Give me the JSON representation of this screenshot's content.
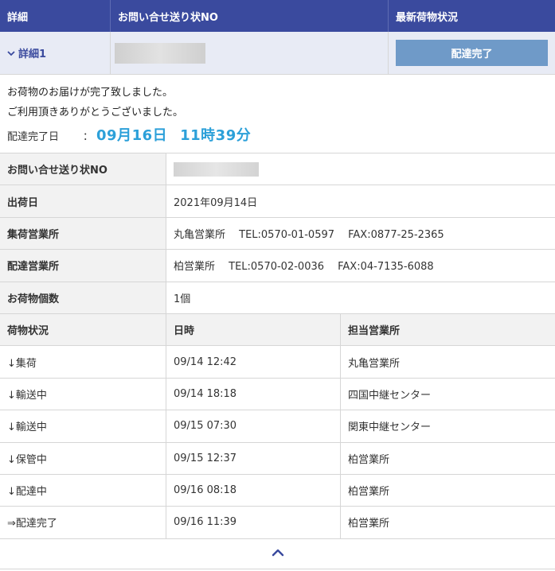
{
  "header": {
    "col1": "詳細",
    "col2": "お問い合せ送り状NO",
    "col3": "最新荷物状況"
  },
  "summary_row": {
    "detail_label": "詳細1",
    "status_button": "配達完了"
  },
  "message": {
    "line1": "お荷物のお届けが完了致しました。",
    "line2": "ご利用頂きありがとうございました。",
    "delivered_label": "配達完了日",
    "colon": "：",
    "delivered_date": "09月16日",
    "delivered_time": "11時39分"
  },
  "info": [
    {
      "label": "お問い合せ送り状NO",
      "value": ""
    },
    {
      "label": "出荷日",
      "value": "2021年09月14日"
    },
    {
      "label": "集荷営業所",
      "value": "丸亀営業所　 TEL:0570-01-0597　 FAX:0877-25-2365"
    },
    {
      "label": "配達営業所",
      "value": "柏営業所　 TEL:0570-02-0036　 FAX:04-7135-6088"
    },
    {
      "label": "お荷物個数",
      "value": "1個"
    }
  ],
  "history": {
    "headers": [
      "荷物状況",
      "日時",
      "担当営業所"
    ],
    "rows": [
      {
        "status": "↓集荷",
        "datetime": "09/14 12:42",
        "office": "丸亀営業所"
      },
      {
        "status": "↓輸送中",
        "datetime": "09/14 18:18",
        "office": "四国中継センター"
      },
      {
        "status": "↓輸送中",
        "datetime": "09/15 07:30",
        "office": "関東中継センター"
      },
      {
        "status": "↓保管中",
        "datetime": "09/15 12:37",
        "office": "柏営業所"
      },
      {
        "status": "↓配達中",
        "datetime": "09/16 08:18",
        "office": "柏営業所"
      },
      {
        "status": "⇒配達完了",
        "datetime": "09/16 11:39",
        "office": "柏営業所"
      }
    ]
  },
  "colors": {
    "header_bg": "#3a4a9e",
    "accent_blue": "#2ca0d9",
    "status_button_bg": "#6f9ac8"
  },
  "icons": {
    "expand": "chevron-down-icon",
    "scroll_top": "chevron-up-icon"
  }
}
